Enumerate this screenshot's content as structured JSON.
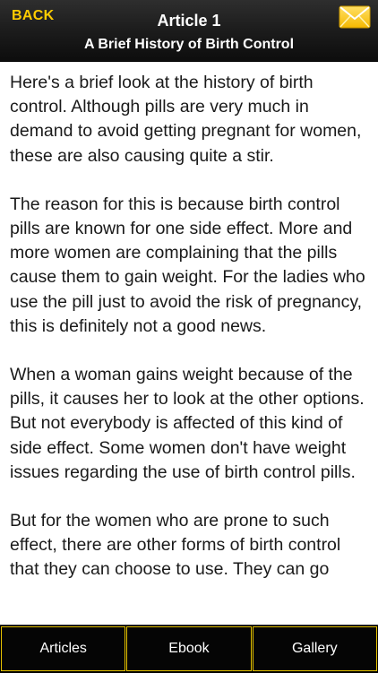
{
  "header": {
    "back_label": "BACK",
    "title": "Article 1",
    "subtitle": "A Brief History of Birth Control",
    "mail_icon": "envelope-icon"
  },
  "article": {
    "paragraphs": [
      "Here's a brief look at the history of birth control. Although pills are very much in demand to avoid getting pregnant for women, these are also causing quite a stir.",
      "The reason for this is because birth control pills are known for one side effect. More and more women are complaining that the pills cause them to gain weight. For the ladies who use the pill just to avoid the risk of pregnancy, this is definitely not a good news.",
      "When a woman gains weight because of the pills, it causes her to look at the other options. But not everybody is affected of this kind of side effect. Some women don't have weight issues regarding the use of birth control pills.",
      "But for the women who are prone to such effect, there are other forms of birth control that they can choose to use. They can go"
    ]
  },
  "tabs": [
    {
      "label": "Articles"
    },
    {
      "label": "Ebook"
    },
    {
      "label": "Gallery"
    }
  ],
  "colors": {
    "accent": "#ffcc00",
    "header_bg": "#1c1c1c",
    "tab_border": "#e6c200"
  }
}
